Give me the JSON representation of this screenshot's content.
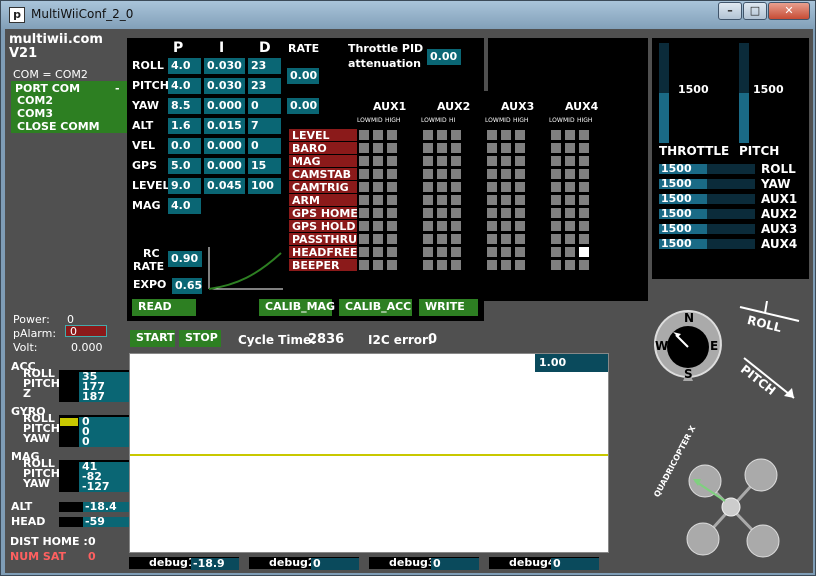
{
  "window": {
    "title": "MultiWiiConf_2_0",
    "icon_letter": "p",
    "min": "–",
    "max": "□",
    "close": "✕"
  },
  "app": {
    "name": "multiwii.com",
    "version": "V21",
    "com": "COM = COM2"
  },
  "ports": {
    "header": "PORT COM",
    "header_sign": "-",
    "items": [
      "COM2",
      "COM3",
      "CLOSE COMM"
    ]
  },
  "pid": {
    "headers": [
      "P",
      "I",
      "D",
      "RATE"
    ],
    "rows": [
      {
        "name": "ROLL",
        "p": "4.0",
        "i": "0.030",
        "d": "23"
      },
      {
        "name": "PITCH",
        "p": "4.0",
        "i": "0.030",
        "d": "23"
      },
      {
        "name": "YAW",
        "p": "8.5",
        "i": "0.000",
        "d": "0"
      },
      {
        "name": "ALT",
        "p": "1.6",
        "i": "0.015",
        "d": "7"
      },
      {
        "name": "VEL",
        "p": "0.0",
        "i": "0.000",
        "d": "0"
      },
      {
        "name": "GPS",
        "p": "5.0",
        "i": "0.000",
        "d": "15"
      },
      {
        "name": "LEVEL",
        "p": "9.0",
        "i": "0.045",
        "d": "100"
      },
      {
        "name": "MAG",
        "p": "4.0"
      }
    ],
    "rate_rollpitch": "0.00",
    "rate_yaw": "0.00",
    "throttle_label_1": "Throttle PID",
    "throttle_label_2": "attenuation",
    "throttle_value": "0.00",
    "rc_label_1": "RC",
    "rc_label_2": "RATE",
    "rc_rate": "0.90",
    "expo_label": "EXPO",
    "expo": "0.65"
  },
  "aux": {
    "headers": [
      "AUX1",
      "AUX2",
      "AUX3",
      "AUX4"
    ],
    "sub": [
      [
        "LOW",
        "MID",
        "HIGH"
      ],
      [
        "LOW",
        "MID",
        "HI"
      ],
      [
        "LOW",
        "MID",
        "HIGH"
      ],
      [
        "LOW",
        "MID",
        "HIGH"
      ]
    ],
    "boxes": [
      "LEVEL",
      "BARO",
      "MAG",
      "CAMSTAB",
      "CAMTRIG",
      "ARM",
      "GPS HOME",
      "GPS HOLD",
      "PASSTHRU",
      "HEADFREE",
      "BEEPER"
    ],
    "active": [
      [
        9,
        11
      ]
    ]
  },
  "buttons": {
    "read": "READ",
    "calib_mag": "CALIB_MAG",
    "calib_acc": "CALIB_ACC",
    "write": "WRITE",
    "start": "START",
    "stop": "STOP"
  },
  "status": {
    "cycle_label": "Cycle Time:",
    "cycle_value": "2836",
    "i2c_label": "I2C error:",
    "i2c_value": "0"
  },
  "power": {
    "power_label": "Power:",
    "power_value": "0",
    "palarm_label": "pAlarm:",
    "palarm_value": "0",
    "volt_label": "Volt:",
    "volt_value": "0.000"
  },
  "sensors": {
    "acc": {
      "label": "ACC",
      "axes": [
        "ROLL",
        "PITCH",
        "Z"
      ],
      "values": [
        "35",
        "177",
        "187"
      ]
    },
    "gyro": {
      "label": "GYRO",
      "axes": [
        "ROLL",
        "PITCH",
        "YAW"
      ],
      "values": [
        "0",
        "0",
        "0"
      ]
    },
    "mag": {
      "label": "MAG",
      "axes": [
        "ROLL",
        "PITCH",
        "YAW"
      ],
      "values": [
        "41",
        "-82",
        "-127"
      ]
    },
    "alt": {
      "label": "ALT",
      "value": "-18.4"
    },
    "head": {
      "label": "HEAD",
      "value": "-59"
    }
  },
  "gps": {
    "dist_home_label": "DIST HOME :",
    "dist_home": "0",
    "num_sat_label": "NUM SAT",
    "num_sat": "0"
  },
  "graph": {
    "scale": "1.00"
  },
  "debug": [
    {
      "label": "debug1",
      "value": "-18.9"
    },
    {
      "label": "debug2",
      "value": "0"
    },
    {
      "label": "debug3",
      "value": "0"
    },
    {
      "label": "debug4",
      "value": "0"
    }
  ],
  "rc": {
    "throttle_label": "THROTTLE",
    "throttle_value": "1500",
    "throttle_level": 0.5,
    "pitch_label": "PITCH",
    "pitch_value": "1500",
    "pitch_level": 0.5,
    "channels": [
      {
        "value": "1500",
        "name": "ROLL"
      },
      {
        "value": "1500",
        "name": "YAW"
      },
      {
        "value": "1500",
        "name": "AUX1"
      },
      {
        "value": "1500",
        "name": "AUX2"
      },
      {
        "value": "1500",
        "name": "AUX3"
      },
      {
        "value": "1500",
        "name": "AUX4"
      }
    ]
  },
  "compass": {
    "n": "N",
    "e": "E",
    "s": "S",
    "w": "W"
  },
  "attitude": {
    "roll": "ROLL",
    "pitch": "PITCH",
    "model": "QUADRICOPTER X"
  },
  "colors": {
    "field": "#0a6674",
    "button": "#2d7f22",
    "box": "#8b1a1a",
    "panel": "#000000",
    "bg": "#505050",
    "trace": "#c8c800"
  }
}
